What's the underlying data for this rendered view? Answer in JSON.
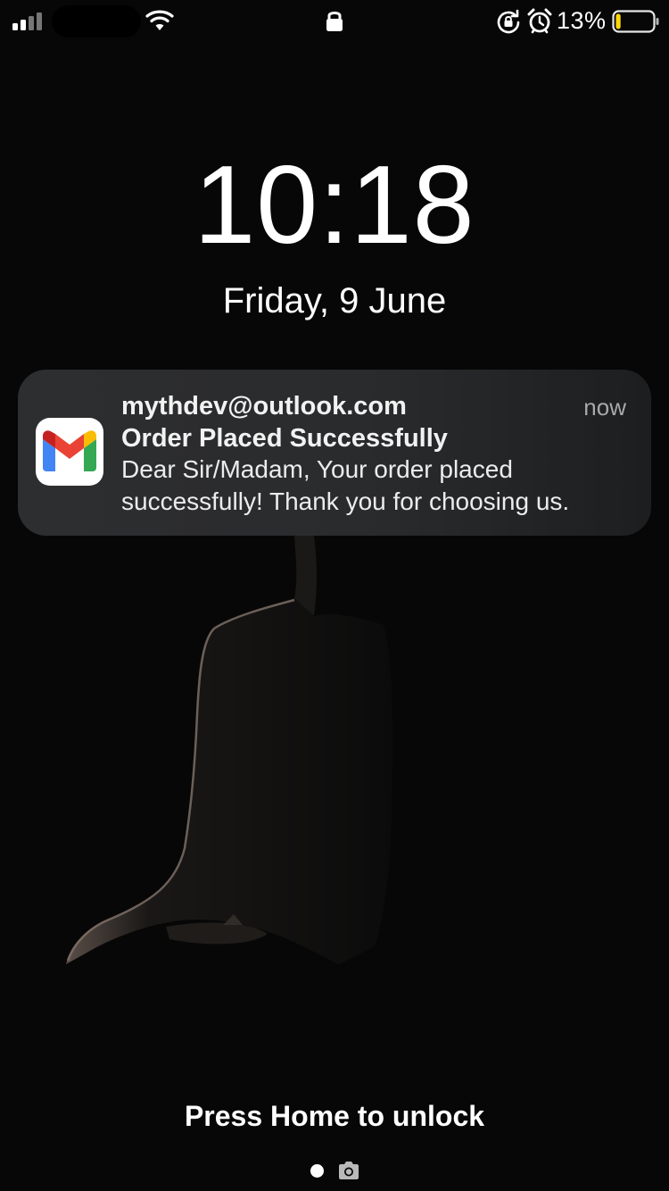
{
  "status_bar": {
    "battery_percent": "13%",
    "battery_level": 0.13,
    "battery_color": "#ffd60a",
    "icons": [
      "signal-icon",
      "wifi-icon",
      "lock-icon",
      "rotation-lock-icon",
      "alarm-icon",
      "battery-icon"
    ]
  },
  "lock_screen": {
    "time": "10:18",
    "date": "Friday, 9 June",
    "unlock_hint": "Press Home to unlock"
  },
  "notification": {
    "app_icon": "gmail-icon",
    "sender": "mythdev@outlook.com",
    "time": "now",
    "title": "Order Placed Successfully",
    "body": "Dear Sir/Madam, Your order placed successfully! Thank you for choosing us."
  },
  "page_indicator": {
    "icons": [
      "page-dot",
      "camera-icon"
    ]
  },
  "colors": {
    "background": "#070707",
    "notification_bg": "#2d2e30",
    "notification_time": "#a9a9ab",
    "gmail_red": "#ea4335",
    "gmail_blue": "#4285f4",
    "gmail_green": "#34a853",
    "gmail_yellow": "#fbbc04"
  }
}
